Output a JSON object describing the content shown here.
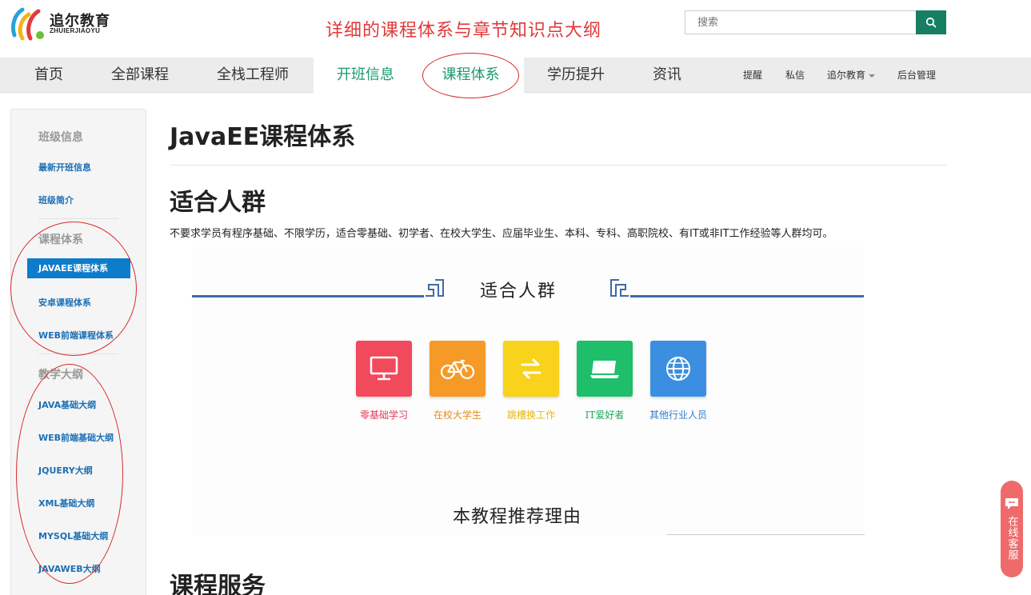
{
  "header": {
    "logo_name": "追尔教育",
    "logo_sub": "ZHUIERJIAOYU",
    "annotation_title": "详细的课程体系与章节知识点大纲",
    "search_placeholder": "搜索"
  },
  "nav": {
    "items": [
      "首页",
      "全部课程",
      "全栈工程师",
      "开班信息",
      "课程体系",
      "学历提升",
      "资讯"
    ],
    "utility": [
      "提醒",
      "私信",
      "追尔教育",
      "后台管理"
    ]
  },
  "sidebar": {
    "sections": [
      {
        "heading": "班级信息",
        "links": [
          "最新开班信息",
          "班级简介"
        ]
      },
      {
        "heading": "课程体系",
        "links": [
          "JAVAEE课程体系",
          "安卓课程体系",
          "WEB前端课程体系"
        ]
      },
      {
        "heading": "教学大纲",
        "links": [
          "JAVA基础大纲",
          "WEB前端基础大纲",
          "JQUERY大纲",
          "XML基础大纲",
          "MYSQL基础大纲",
          "JAVAWEB大纲"
        ]
      }
    ]
  },
  "main": {
    "page_title": "JavaEE课程体系",
    "section1_title": "适合人群",
    "section1_desc": "不要求学员有程序基础、不限学历，适合零基础、初学者、在校大学生、应届毕业生、本科、专科、高职院校、有IT或非IT工作经验等人群均可。",
    "banner": {
      "title": "适合人群",
      "tiles": [
        {
          "label": "零基础学习",
          "color": "#f04a5c",
          "label_color": "#e0395a",
          "icon": "monitor-icon"
        },
        {
          "label": "在校大学生",
          "color": "#f59a26",
          "label_color": "#e88a1a",
          "icon": "bicycle-icon"
        },
        {
          "label": "跳槽换工作",
          "color": "#f8d21b",
          "label_color": "#e5b80a",
          "icon": "switch-icon"
        },
        {
          "label": "IT爱好者",
          "color": "#1fbe6a",
          "label_color": "#18a85a",
          "icon": "laptop-icon"
        },
        {
          "label": "其他行业人员",
          "color": "#3c8fe0",
          "label_color": "#2f7dd0",
          "icon": "globe-icon"
        }
      ],
      "subtitle": "本教程推荐理由"
    },
    "section2_title": "课程服务"
  },
  "chat": {
    "label": "在线客服"
  }
}
